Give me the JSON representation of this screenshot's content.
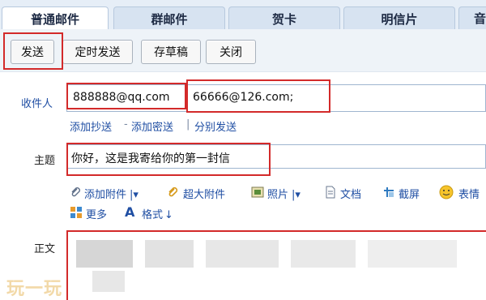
{
  "tabs": [
    {
      "label": "普通邮件",
      "active": true
    },
    {
      "label": "群邮件"
    },
    {
      "label": "贺卡"
    },
    {
      "label": "明信片"
    },
    {
      "label": "音"
    }
  ],
  "toolbar": {
    "send": "发送",
    "schedule": "定时发送",
    "draft": "存草稿",
    "close": "关闭"
  },
  "recipient": {
    "label": "收件人",
    "addr1": "888888@qq.com",
    "addr2": "66666@126.com;"
  },
  "links": {
    "cc": "添加抄送",
    "bcc": "添加密送",
    "separate": "分别发送",
    "dash": "-",
    "bar": "|"
  },
  "subject": {
    "label": "主题",
    "value": "你好，这是我寄给你的第一封信"
  },
  "attachments": {
    "add": "添加附件",
    "big": "超大附件",
    "photo": "照片",
    "doc": "文档",
    "screenshot": "截屏",
    "emoji": "表情",
    "more": "更多",
    "format": "格式"
  },
  "body": {
    "label": "正文"
  },
  "watermark": "玩一玩",
  "colors": {
    "highlight": "#d32a2a",
    "link": "#1f4ea3"
  }
}
